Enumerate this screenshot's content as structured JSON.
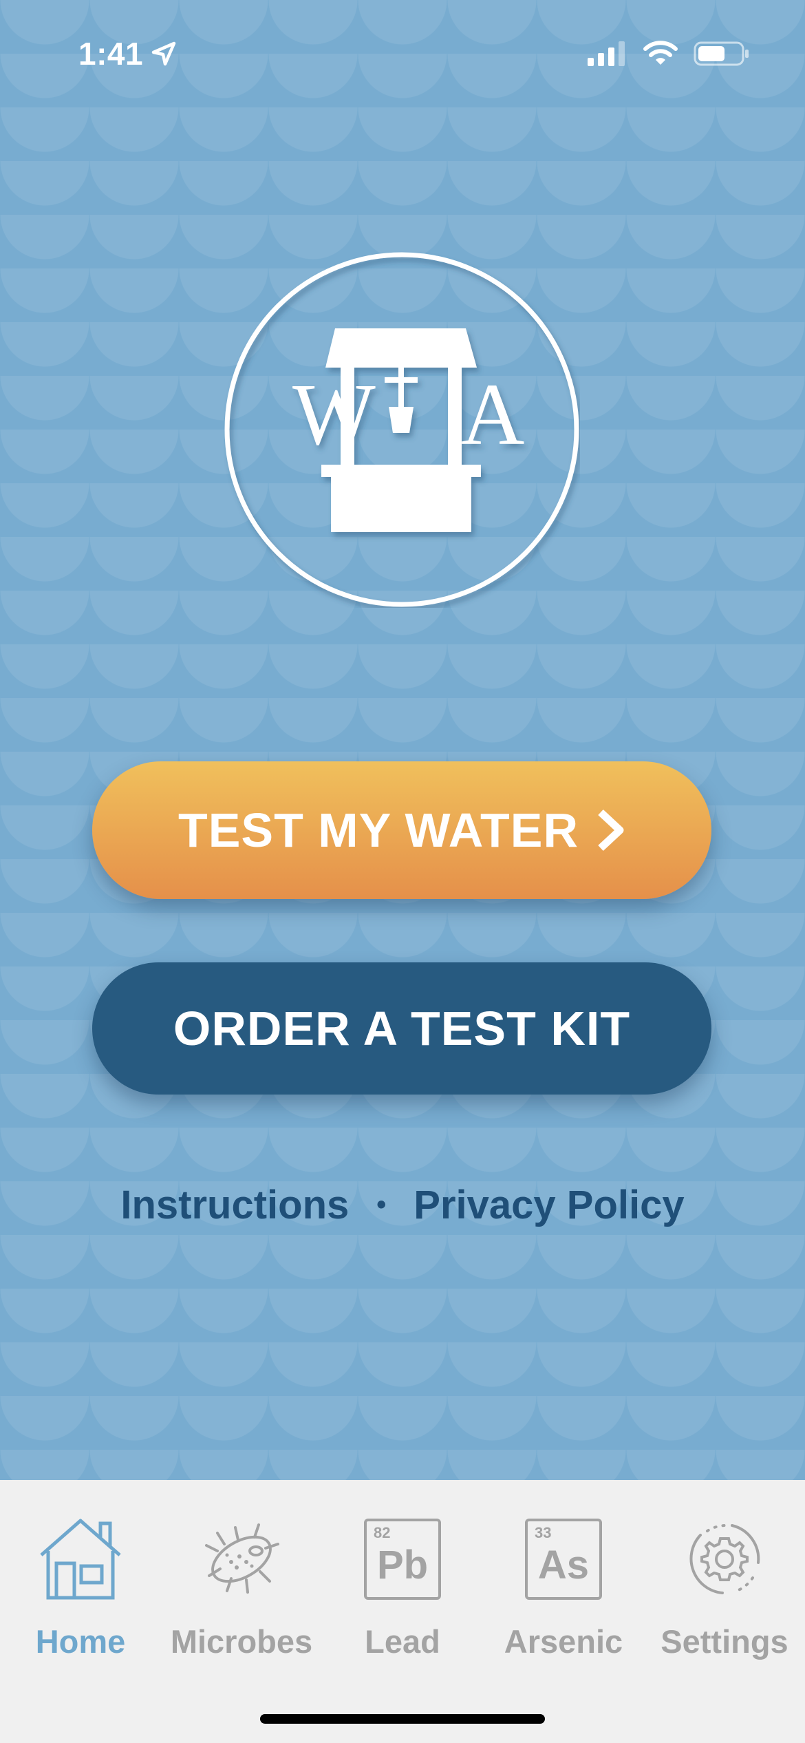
{
  "status_bar": {
    "time": "1:41"
  },
  "logo": {
    "letter_left": "W",
    "letter_right": "A"
  },
  "actions": {
    "test_label": "TEST MY WATER",
    "order_label": "ORDER A TEST KIT"
  },
  "links": {
    "instructions": "Instructions",
    "separator": "•",
    "privacy": "Privacy Policy"
  },
  "tabs": [
    {
      "label": "Home",
      "icon": "house-icon",
      "active": true
    },
    {
      "label": "Microbes",
      "icon": "microbe-icon",
      "active": false
    },
    {
      "label": "Lead",
      "icon": "lead-element-icon",
      "number": "82",
      "symbol": "Pb",
      "active": false
    },
    {
      "label": "Arsenic",
      "icon": "arsenic-element-icon",
      "number": "33",
      "symbol": "As",
      "active": false
    },
    {
      "label": "Settings",
      "icon": "gear-icon",
      "active": false
    }
  ],
  "colors": {
    "background": "#78acd0",
    "test_button_top": "#f0c05c",
    "test_button_bottom": "#e5904a",
    "order_button": "#275a80",
    "link_text": "#1f4f78",
    "tab_active": "#6ea7cd",
    "tab_inactive": "#a3a3a3"
  }
}
